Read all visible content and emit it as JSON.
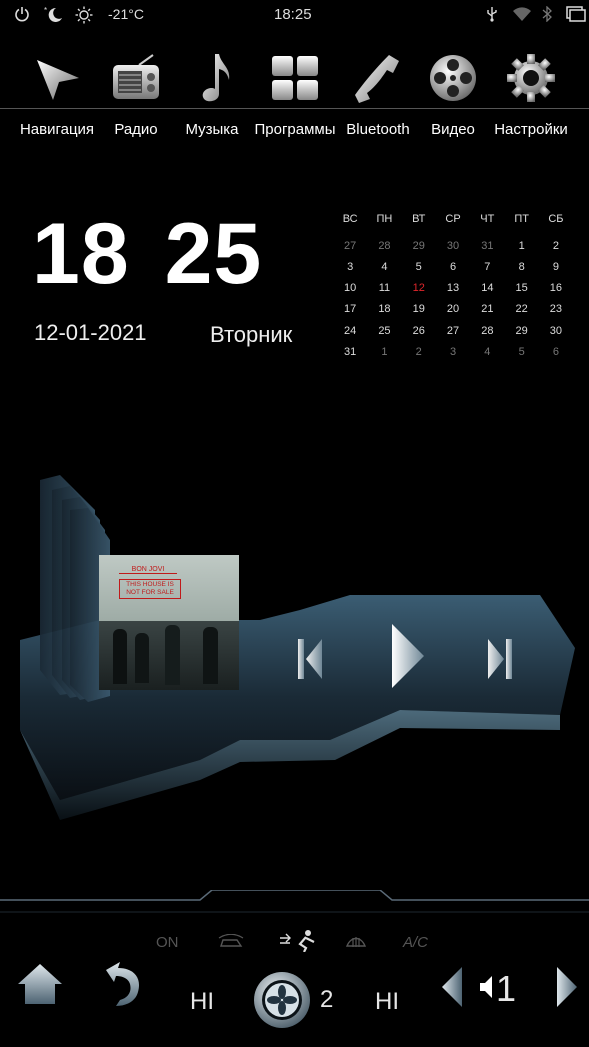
{
  "status": {
    "temperature": "-21°C",
    "time": "18:25",
    "icons": [
      "power-icon",
      "night-mode-icon",
      "brightness-icon",
      "usb-icon",
      "wifi-icon",
      "bluetooth-icon",
      "window-icon"
    ]
  },
  "apps": [
    {
      "label": "Навигация",
      "icon": "navigation-icon"
    },
    {
      "label": "Радио",
      "icon": "radio-icon"
    },
    {
      "label": "Музыка",
      "icon": "music-note-icon"
    },
    {
      "label": "Программы",
      "icon": "apps-grid-icon"
    },
    {
      "label": "Bluetooth",
      "icon": "phone-icon"
    },
    {
      "label": "Видео",
      "icon": "film-reel-icon"
    },
    {
      "label": "Настройки",
      "icon": "gear-icon"
    }
  ],
  "clock": {
    "hours": "18",
    "minutes": "25",
    "date": "12-01-2021",
    "weekday": "Вторник"
  },
  "calendar": {
    "headers": [
      "ВС",
      "ПН",
      "ВТ",
      "СР",
      "ЧТ",
      "ПТ",
      "СБ"
    ],
    "weeks": [
      [
        {
          "d": "27",
          "dim": true
        },
        {
          "d": "28",
          "dim": true
        },
        {
          "d": "29",
          "dim": true
        },
        {
          "d": "30",
          "dim": true
        },
        {
          "d": "31",
          "dim": true
        },
        {
          "d": "1"
        },
        {
          "d": "2"
        }
      ],
      [
        {
          "d": "3"
        },
        {
          "d": "4"
        },
        {
          "d": "5"
        },
        {
          "d": "6"
        },
        {
          "d": "7"
        },
        {
          "d": "8"
        },
        {
          "d": "9"
        }
      ],
      [
        {
          "d": "10"
        },
        {
          "d": "11"
        },
        {
          "d": "12",
          "today": true
        },
        {
          "d": "13"
        },
        {
          "d": "14"
        },
        {
          "d": "15"
        },
        {
          "d": "16"
        }
      ],
      [
        {
          "d": "17"
        },
        {
          "d": "18"
        },
        {
          "d": "19"
        },
        {
          "d": "20"
        },
        {
          "d": "21"
        },
        {
          "d": "22"
        },
        {
          "d": "23"
        }
      ],
      [
        {
          "d": "24"
        },
        {
          "d": "25"
        },
        {
          "d": "26"
        },
        {
          "d": "27"
        },
        {
          "d": "28"
        },
        {
          "d": "29"
        },
        {
          "d": "30"
        }
      ],
      [
        {
          "d": "31"
        },
        {
          "d": "1",
          "dim": true
        },
        {
          "d": "2",
          "dim": true
        },
        {
          "d": "3",
          "dim": true
        },
        {
          "d": "4",
          "dim": true
        },
        {
          "d": "5",
          "dim": true
        },
        {
          "d": "6",
          "dim": true
        }
      ]
    ]
  },
  "player": {
    "album_artist": "BON JOVI",
    "album_title": "THIS HOUSE IS NOT FOR SALE",
    "controls": [
      "previous-icon",
      "play-icon",
      "next-icon"
    ]
  },
  "climate": {
    "on_label": "ON",
    "ac_label": "A/C",
    "left_temp": "HI",
    "fan_speed": "2",
    "right_temp": "HI",
    "volume": "1",
    "colors": {
      "accent": "#3a6f8f",
      "dim": "#555555",
      "today": "#e0262b"
    }
  }
}
